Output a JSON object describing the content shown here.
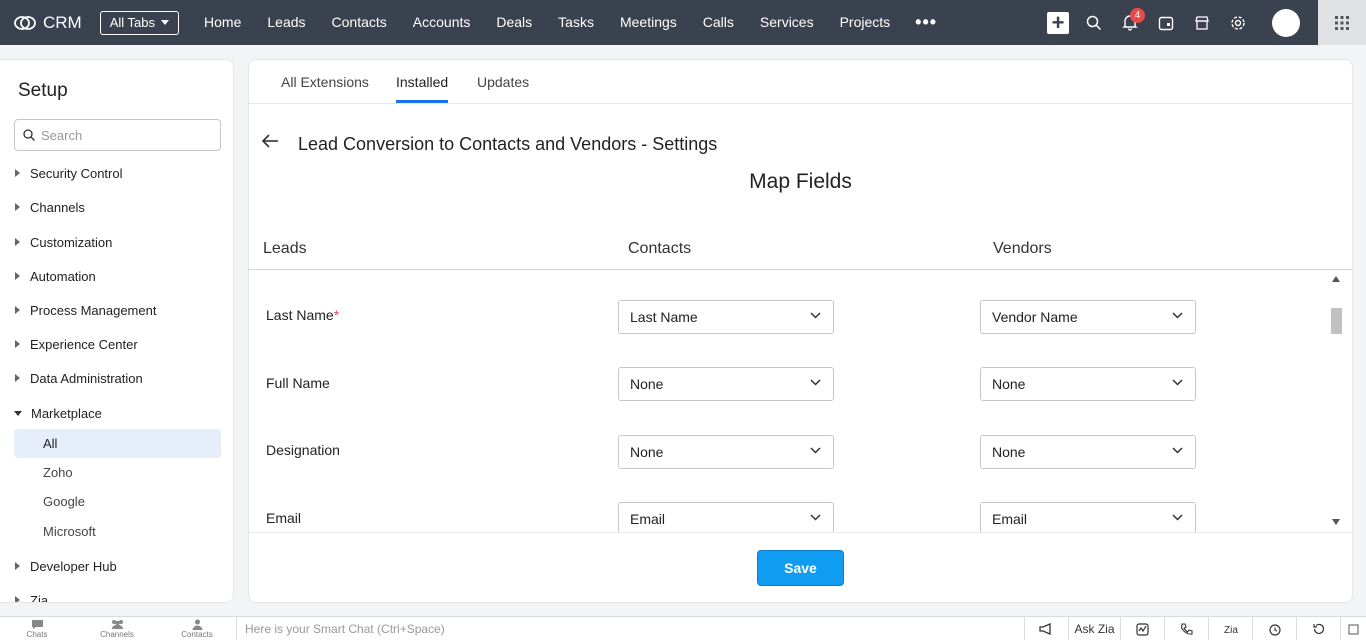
{
  "topbar": {
    "app_name": "CRM",
    "all_tabs_label": "All Tabs",
    "tabs": [
      "Home",
      "Leads",
      "Contacts",
      "Accounts",
      "Deals",
      "Tasks",
      "Meetings",
      "Calls",
      "Services",
      "Projects"
    ],
    "more_label": "•••",
    "notification_count": "4",
    "icons": [
      "plus-icon",
      "search-icon",
      "bell-icon",
      "calendar-icon",
      "store-icon",
      "gear-icon",
      "avatar",
      "apps-grid-icon"
    ]
  },
  "sidebar": {
    "title": "Setup",
    "search_placeholder": "Search",
    "items": [
      {
        "label": "Security Control"
      },
      {
        "label": "Channels"
      },
      {
        "label": "Customization"
      },
      {
        "label": "Automation"
      },
      {
        "label": "Process Management"
      },
      {
        "label": "Experience Center"
      },
      {
        "label": "Data Administration"
      },
      {
        "label": "Marketplace"
      },
      {
        "label": "Developer Hub"
      },
      {
        "label": "Zia"
      }
    ],
    "marketplace_subitems": [
      {
        "label": "All"
      },
      {
        "label": "Zoho"
      },
      {
        "label": "Google"
      },
      {
        "label": "Microsoft"
      }
    ]
  },
  "main": {
    "tabs": [
      {
        "label": "All Extensions"
      },
      {
        "label": "Installed"
      },
      {
        "label": "Updates"
      }
    ],
    "active_tab": "Installed",
    "page_title": "Lead Conversion to Contacts and Vendors - Settings",
    "map_title": "Map Fields",
    "columns": [
      "Leads",
      "Contacts",
      "Vendors"
    ],
    "rows": [
      {
        "label": "Last Name",
        "required": "*",
        "contacts": "Last Name",
        "vendors": "Vendor Name"
      },
      {
        "label": "Full Name",
        "contacts": "None",
        "vendors": "None"
      },
      {
        "label": "Designation",
        "contacts": "None",
        "vendors": "None"
      },
      {
        "label": "Email",
        "contacts": "Email",
        "vendors": "Email"
      }
    ],
    "save_label": "Save"
  },
  "bottombar": {
    "items": [
      {
        "label": "Chats"
      },
      {
        "label": "Channels"
      },
      {
        "label": "Contacts"
      }
    ],
    "smart_chat_placeholder": "Here is your Smart Chat (Ctrl+Space)",
    "ask_zia_label": "Ask Zia"
  },
  "colors": {
    "topbar": "#3a4250",
    "accent": "#1a73e8",
    "save_button": "#109cf1",
    "badge": "#e84a4a",
    "active_sub_item": "#e6eef9"
  }
}
